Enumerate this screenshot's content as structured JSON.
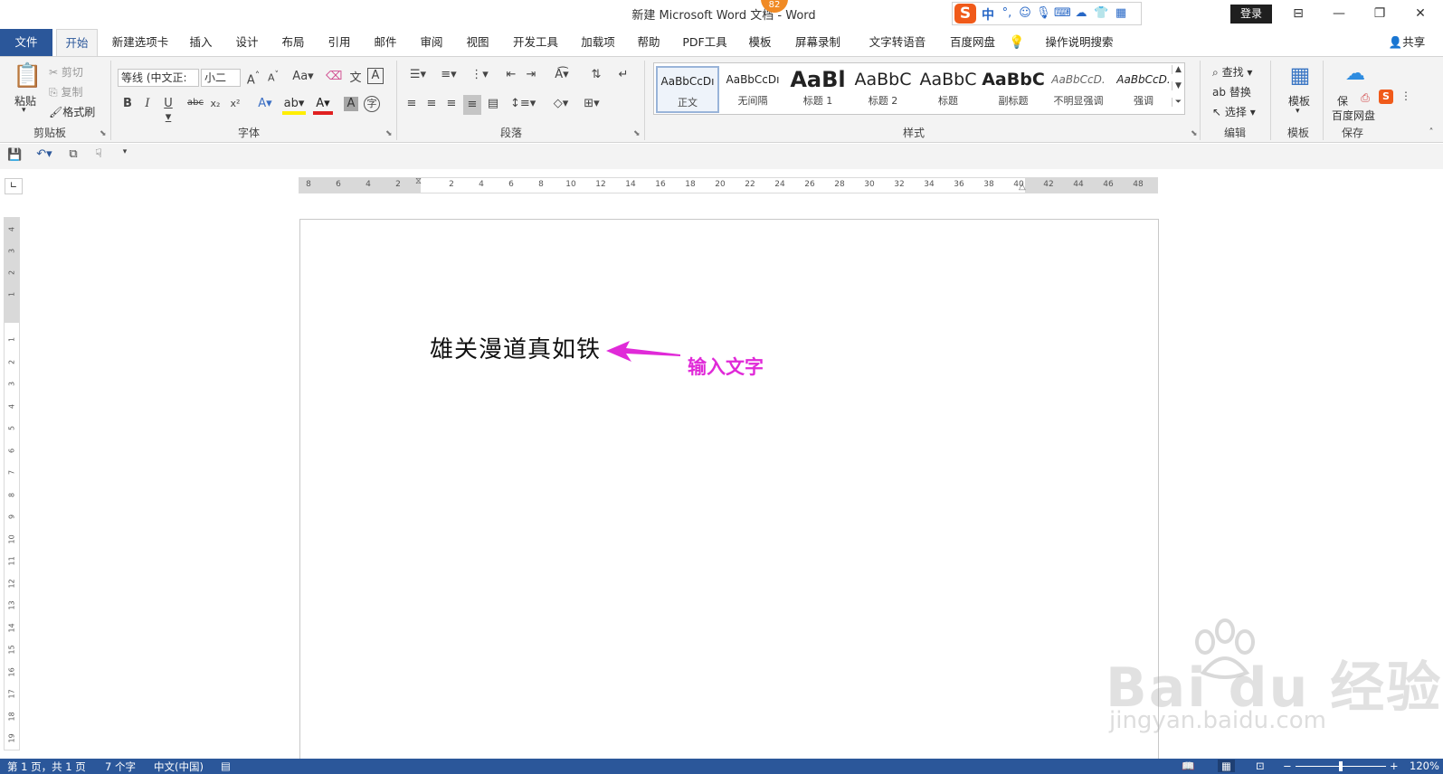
{
  "titlebar": {
    "title": "新建 Microsoft Word 文档 - Word",
    "badge_count": "82",
    "ime_logo": "S",
    "ime_mode": "中",
    "login_label": "登录"
  },
  "tabs": [
    "文件",
    "开始",
    "新建选项卡",
    "插入",
    "设计",
    "布局",
    "引用",
    "邮件",
    "审阅",
    "视图",
    "开发工具",
    "加载项",
    "帮助",
    "PDF工具",
    "模板",
    "屏幕录制",
    "文字转语音",
    "百度网盘",
    "操作说明搜索"
  ],
  "share_label": "共享",
  "ribbon": {
    "clipboard": {
      "paste": "粘贴",
      "cut": "剪切",
      "copy": "复制",
      "format_painter": "格式刷",
      "label": "剪贴板"
    },
    "font": {
      "font_name": "等线 (中文正:",
      "font_size": "小二",
      "label": "字体",
      "change_case": "Aa"
    },
    "paragraph": {
      "label": "段落"
    },
    "styles": {
      "label": "样式",
      "items": [
        {
          "preview": "AaBbCcDı",
          "name": "正文"
        },
        {
          "preview": "AaBbCcDı",
          "name": "无间隔"
        },
        {
          "preview": "AaBl",
          "name": "标题 1"
        },
        {
          "preview": "AaBbC",
          "name": "标题 2"
        },
        {
          "preview": "AaBbC",
          "name": "标题"
        },
        {
          "preview": "AaBbC",
          "name": "副标题"
        },
        {
          "preview": "AaBbCcD.",
          "name": "不明显强调"
        },
        {
          "preview": "AaBbCcD.",
          "name": "强调"
        }
      ]
    },
    "editing": {
      "find": "查找",
      "replace": "替换",
      "select": "选择",
      "label": "编辑"
    },
    "template": {
      "button": "模板",
      "label": "模板"
    },
    "save": {
      "button_line1": "保",
      "button_line2": "百度网盘",
      "label": "保存"
    }
  },
  "ruler": {
    "h_numbers": [
      "8",
      "6",
      "4",
      "2",
      "2",
      "4",
      "6",
      "8",
      "10",
      "12",
      "14",
      "16",
      "18",
      "20",
      "22",
      "24",
      "26",
      "28",
      "30",
      "32",
      "34",
      "36",
      "38",
      "40",
      "42",
      "44",
      "46",
      "48"
    ],
    "v_numbers": [
      "4",
      "3",
      "2",
      "1",
      "1",
      "2",
      "3",
      "4",
      "5",
      "6",
      "7",
      "8",
      "9",
      "10",
      "11",
      "12",
      "13",
      "14",
      "15",
      "16",
      "17",
      "18",
      "19"
    ]
  },
  "document": {
    "text": "雄关漫道真如铁",
    "annotation": "输入文字"
  },
  "watermark": {
    "logo": "Bai du 经验",
    "url": "jingyan.baidu.com"
  },
  "status": {
    "page": "第 1 页，共 1 页",
    "words": "7 个字",
    "language": "中文(中国)",
    "zoom": "120%"
  },
  "colors": {
    "accent": "#2b579a",
    "annotation": "#e02ad8",
    "ime": "#f05a1a"
  }
}
